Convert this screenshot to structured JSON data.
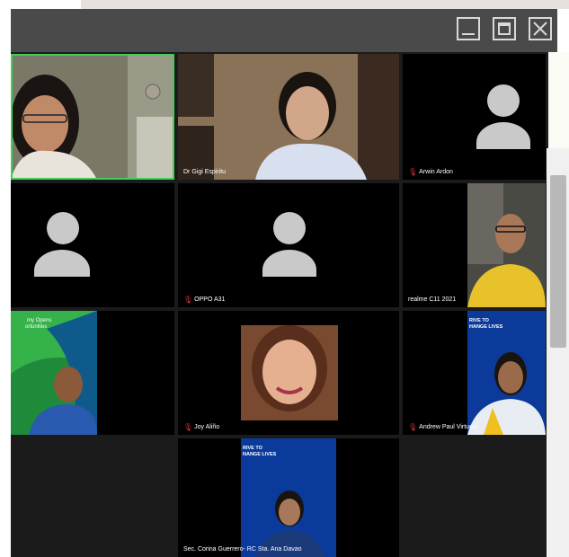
{
  "window": {
    "controls": {
      "minimize": "minimize",
      "maximize": "maximize",
      "close": "close"
    }
  },
  "participants": [
    {
      "name": "",
      "muted": false,
      "video": true,
      "active_speaker": true
    },
    {
      "name": "Dr Gigi Espiritu",
      "muted": false,
      "video": true
    },
    {
      "name": "Arwin Ardon",
      "muted": true,
      "video": false
    },
    {
      "name": "",
      "muted": false,
      "video": false
    },
    {
      "name": "OPPO A31",
      "muted": true,
      "video": false
    },
    {
      "name": "realme C11 2021",
      "muted": false,
      "video": true
    },
    {
      "name": "",
      "muted": false,
      "video": true
    },
    {
      "name": "Joy Aliño",
      "muted": true,
      "video": true
    },
    {
      "name": "Andrew Paul Virtucio",
      "muted": true,
      "video": true
    },
    {
      "name": "Sec. Corina Guerrero- RC Sta. Ana Davao",
      "muted": false,
      "video": true
    }
  ],
  "backgrounds": {
    "green_banner_text": "my Opens\nortunities",
    "blue_banner_text_1": "RIVE TO\nHANGE LIVES",
    "blue_banner_text_2": "RIVE TO\nNANGE LIVES"
  },
  "colors": {
    "active_border": "#3ecf5a",
    "muted_mic": "#e0333f",
    "avatar": "#c9c9c9"
  }
}
